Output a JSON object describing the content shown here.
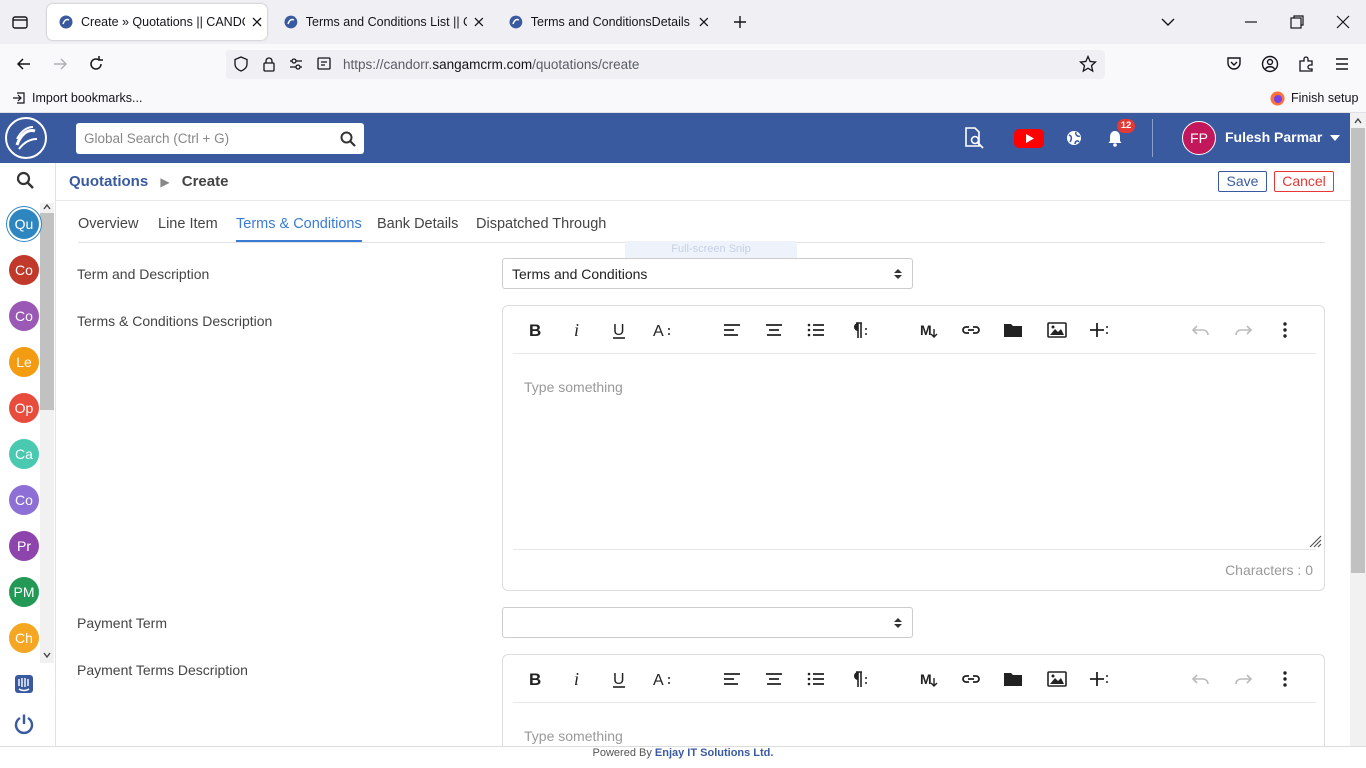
{
  "browser": {
    "tabs": [
      {
        "title": "Create » Quotations || CANDOR",
        "active": true
      },
      {
        "title": "Terms and Conditions List || CA",
        "active": false
      },
      {
        "title": "Terms and ConditionsDetails || C",
        "active": false
      }
    ],
    "url_prefix": "https://candorr.",
    "url_domain": "sangamcrm.com",
    "url_path": "/quotations/create",
    "import_bookmarks": "Import bookmarks...",
    "finish_setup": "Finish setup"
  },
  "header": {
    "search_placeholder": "Global Search (Ctrl + G)",
    "notification_count": "12",
    "user_initials": "FP",
    "user_name": "Fulesh Parmar"
  },
  "sidebar": {
    "modules": [
      {
        "label": "Qu",
        "color": "#2e86c1",
        "selected": true
      },
      {
        "label": "Co",
        "color": "#c0392b"
      },
      {
        "label": "Co",
        "color": "#9b59b6"
      },
      {
        "label": "Le",
        "color": "#f39c12"
      },
      {
        "label": "Op",
        "color": "#e74c3c"
      },
      {
        "label": "Ca",
        "color": "#48c9b0"
      },
      {
        "label": "Co",
        "color": "#8e6fd6"
      },
      {
        "label": "Pr",
        "color": "#8e44ad"
      },
      {
        "label": "PM",
        "color": "#229954"
      },
      {
        "label": "Ch",
        "color": "#f5a623"
      }
    ]
  },
  "breadcrumb": {
    "module": "Quotations",
    "page": "Create"
  },
  "actions": {
    "save": "Save",
    "cancel": "Cancel"
  },
  "tabs": [
    "Overview",
    "Line Item",
    "Terms & Conditions",
    "Bank Details",
    "Dispatched Through"
  ],
  "active_tab": "Terms & Conditions",
  "snip_overlay": "Full-screen Snip",
  "form": {
    "term_label": "Term and Description",
    "term_value": "Terms and Conditions",
    "tc_desc_label": "Terms & Conditions Description",
    "tc_placeholder": "Type something",
    "tc_char_count": "Characters : 0",
    "payment_term_label": "Payment Term",
    "payment_term_value": "",
    "payment_desc_label": "Payment Terms Description",
    "payment_placeholder": "Type something"
  },
  "footer": {
    "prefix": "Powered By",
    "brand": "Enjay IT Solutions Ltd."
  },
  "colors": {
    "header": "#3a5aa0",
    "accent": "#3a7bd5",
    "cancel": "#e53935"
  }
}
